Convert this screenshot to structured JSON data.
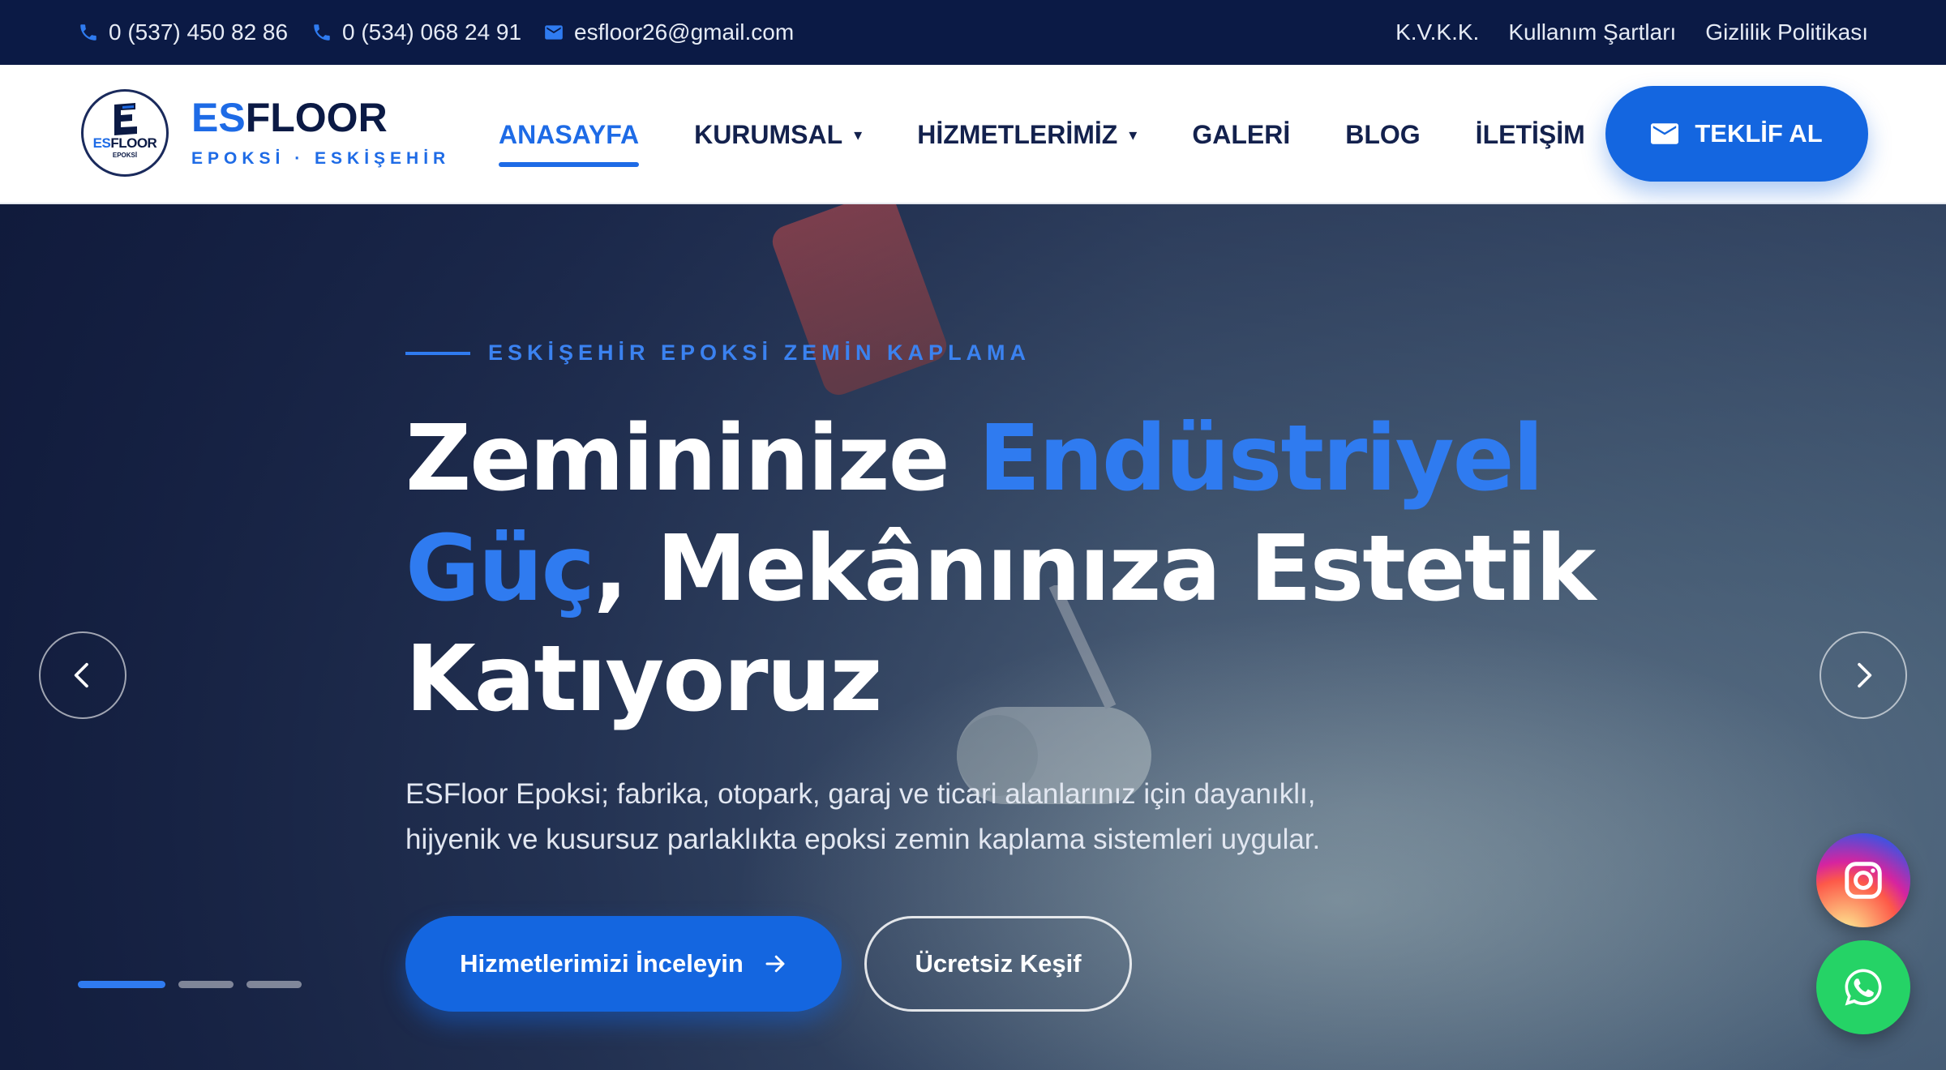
{
  "topbar": {
    "phone1": "0 (537) 450 82 86",
    "phone2": "0 (534) 068 24 91",
    "email": "esfloor26@gmail.com",
    "links": [
      "K.V.K.K.",
      "Kullanım Şartları",
      "Gizlilik Politikası"
    ]
  },
  "brand": {
    "name_accent": "ES",
    "name_rest": "FLOOR",
    "tagline": "EPOKSİ · ESKİŞEHİR",
    "badge_accent": "ES",
    "badge_rest": "FLOOR",
    "badge_sub": "EPOKSİ"
  },
  "nav": {
    "items": [
      {
        "label": "ANASAYFA",
        "active": true
      },
      {
        "label": "KURUMSAL",
        "dropdown": true
      },
      {
        "label": "HİZMETLERİMİZ",
        "dropdown": true
      },
      {
        "label": "GALERİ"
      },
      {
        "label": "BLOG"
      },
      {
        "label": "İLETİŞİM"
      }
    ],
    "cta_label": "TEKLİF AL"
  },
  "hero": {
    "eyebrow": "ESKİŞEHİR EPOKSİ ZEMİN KAPLAMA",
    "headline": {
      "part1": "Zemininize ",
      "highlight1": "Endüstriyel Güç",
      "part2": ", Mekânınıza Estetik Katıyoruz"
    },
    "lead_line1": "ESFloor Epoksi; fabrika, otopark, garaj ve ticari alanlarınız için dayanıklı,",
    "lead_line2": "hijyenik ve kusursuz parlaklıkta epoksi zemin kaplama sistemleri uygular.",
    "primary_button": "Hizmetlerimizi İnceleyin",
    "secondary_button": "Ücretsiz Keşif",
    "slides": {
      "count": 3,
      "active": 1
    }
  },
  "colors": {
    "topbar_bg": "#0b1a45",
    "accent": "#1466e0",
    "highlight": "#2f7bf0",
    "whatsapp": "#25d366"
  },
  "icons": [
    "phone-icon",
    "email-icon",
    "envelope-icon",
    "arrow-right-icon",
    "chevron-left-icon",
    "chevron-right-icon",
    "instagram-icon",
    "whatsapp-icon"
  ]
}
